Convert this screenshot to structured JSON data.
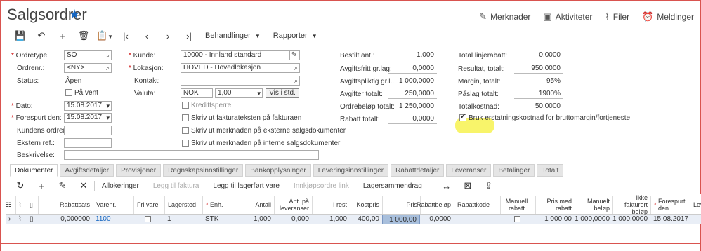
{
  "header": {
    "title": "Salgsordrer",
    "actions": [
      "Merknader",
      "Aktiviteter",
      "Filer",
      "Meldinger"
    ]
  },
  "toolbar": {
    "menus": [
      "Behandlinger",
      "Rapporter"
    ]
  },
  "form": {
    "ordretype": {
      "label": "Ordretype:",
      "value": "SO"
    },
    "ordrenr": {
      "label": "Ordrenr.:",
      "value": "<NY>"
    },
    "status": {
      "label": "Status:",
      "value": "Åpen"
    },
    "pa_vent": "På vent",
    "dato": {
      "label": "Dato:",
      "value": "15.08.2017"
    },
    "forespurt": {
      "label": "Forespurt den:",
      "value": "15.08.2017"
    },
    "kundens_ordrenr": {
      "label": "Kundens ordrenr.:",
      "value": ""
    },
    "ekstern_ref": {
      "label": "Ekstern ref.:",
      "value": ""
    },
    "beskrivelse": {
      "label": "Beskrivelse:",
      "value": ""
    },
    "kunde": {
      "label": "Kunde:",
      "value": "10000 - Innland standard"
    },
    "lokasjon": {
      "label": "Lokasjon:",
      "value": "HOVED - Hovedlokasjon"
    },
    "kontakt": {
      "label": "Kontakt:",
      "value": ""
    },
    "valuta": {
      "label": "Valuta:",
      "value": "NOK",
      "rate": "1,00",
      "button": "Vis i std."
    },
    "checks": [
      "Kredittsperre",
      "Skriv ut fakturateksten på fakturaen",
      "Skriv ut merknaden på eksterne salgsdokumenter",
      "Skriv ut merknaden på interne salgsdokumenter"
    ],
    "mid": [
      {
        "label": "Bestilt ant.:",
        "value": "1,000"
      },
      {
        "label": "Avgiftsfritt gr.lag:",
        "value": "0,0000"
      },
      {
        "label": "Avgiftspliktig gr.l...",
        "value": "1 000,0000"
      },
      {
        "label": "Avgifter totalt:",
        "value": "250,0000"
      },
      {
        "label": "Ordrebeløp totalt:",
        "value": "1 250,0000"
      },
      {
        "label": "Rabatt totalt:",
        "value": "0,0000"
      }
    ],
    "right": [
      {
        "label": "Total linjerabatt:",
        "value": "0,0000"
      },
      {
        "label": "Resultat, totalt:",
        "value": "950,0000"
      },
      {
        "label": "Margin, totalt:",
        "value": "95%"
      },
      {
        "label": "Påslag totalt:",
        "value": "1900%"
      },
      {
        "label": "Totalkostnad:",
        "value": "50,0000"
      }
    ],
    "bruk": "Bruk erstatningskostnad for bruttomargin/fortjeneste"
  },
  "tabs": [
    "Dokumenter",
    "Avgiftsdetaljer",
    "Provisjoner",
    "Regnskapsinnstillinger",
    "Bankopplysninger",
    "Leveringsinnstillinger",
    "Rabattdetaljer",
    "Leveranser",
    "Betalinger",
    "Totalt"
  ],
  "grid_toolbar": {
    "allokeringer": "Allokeringer",
    "legg_faktura": "Legg til faktura",
    "legg_lager": "Legg til lagerført vare",
    "innkjop": "Innkjøpsordre link",
    "lagersammendrag": "Lagersammendrag"
  },
  "grid": {
    "headers": [
      "Rabattsats",
      "Varenr.",
      "Fri vare",
      "Lagersted",
      "Enh.",
      "Antall",
      "Ant. på leveranser",
      "I rest",
      "Kostpris",
      "Pris",
      "Rabattbeløp",
      "Rabattkode",
      "Manuell rabatt",
      "Pris med rabatt",
      "Manuelt beløp",
      "Ikke fakturert beløp",
      "Forespurt den",
      "Lev"
    ],
    "row": {
      "rabattsats": "0,000000",
      "varenr": "1100",
      "lagersted": "1",
      "enh": "STK",
      "antall": "1,000",
      "ant_lev": "0,000",
      "i_rest": "1,000",
      "kostpris": "400,00",
      "pris": "1 000,00",
      "rabattbelop": "0,0000",
      "pris_rabatt": "1 000,00",
      "manuelt": "1 000,0000",
      "ikke_fakt": "1 000,0000",
      "forespurt": "15.08.2017"
    }
  }
}
